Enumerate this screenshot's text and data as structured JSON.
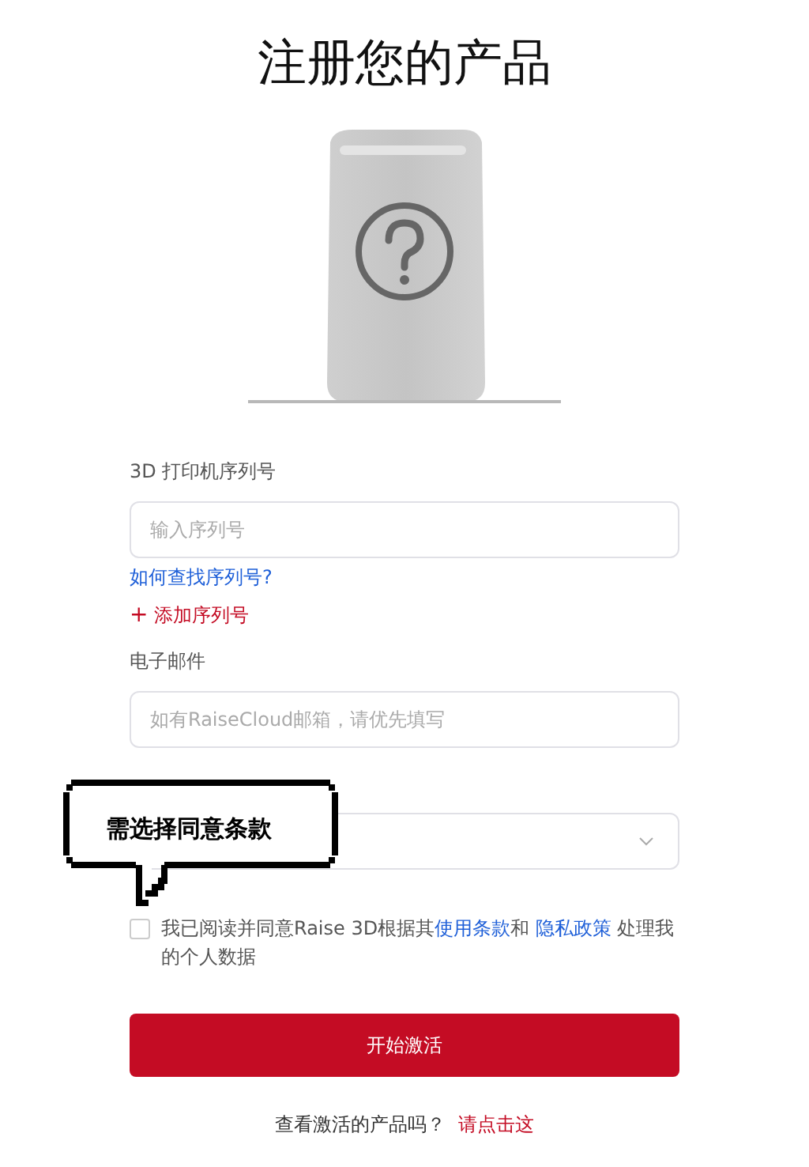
{
  "title": "注册您的产品",
  "product_image": {
    "kind": "unknown-printer"
  },
  "fields": [
    {
      "kind": "text",
      "label": "3D 打印机序列号",
      "placeholder": "输入序列号",
      "links": [
        {
          "text": "如何查找序列号?",
          "kind": "help"
        },
        {
          "text": "添加序列号",
          "kind": "add",
          "icon": "+"
        }
      ]
    },
    {
      "kind": "text",
      "label": "电子邮件",
      "placeholder": "如有RaiseCloud邮箱，请优先填写"
    },
    {
      "kind": "select"
    }
  ],
  "tooltip": "需选择同意条款",
  "agree": {
    "checked": false,
    "parts": [
      {
        "kind": "text",
        "text": "我已阅读并同意Raise 3D根据其"
      },
      {
        "kind": "link",
        "text": "使用条款"
      },
      {
        "kind": "text",
        "text": "和 "
      },
      {
        "kind": "link",
        "text": "隐私政策"
      },
      {
        "kind": "text",
        "text": " 处理我的个人数据"
      }
    ]
  },
  "submit": "开始激活",
  "footer": {
    "text": "查看激活的产品吗？",
    "link": "请点击这"
  }
}
